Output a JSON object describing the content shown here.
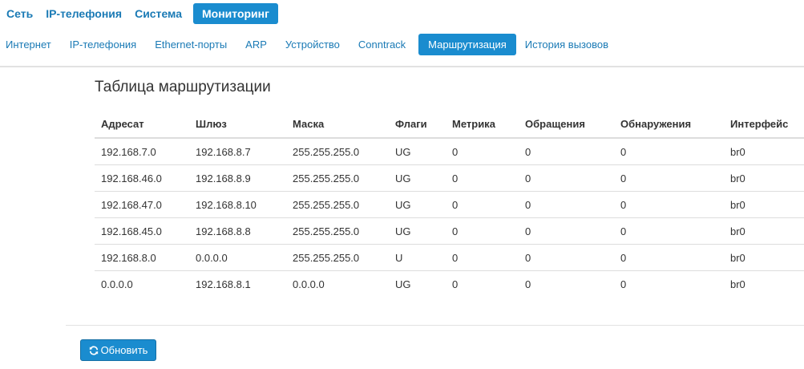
{
  "top_nav": {
    "tabs": [
      {
        "label": "Сеть"
      },
      {
        "label": "IP-телефония"
      },
      {
        "label": "Система"
      },
      {
        "label": "Мониторинг"
      }
    ],
    "active_index": 3
  },
  "sub_nav": {
    "tabs": [
      {
        "label": "Интернет"
      },
      {
        "label": "IP-телефония"
      },
      {
        "label": "Ethernet-порты"
      },
      {
        "label": "ARP"
      },
      {
        "label": "Устройство"
      },
      {
        "label": "Conntrack"
      },
      {
        "label": "Маршрутизация"
      },
      {
        "label": "История вызовов"
      }
    ],
    "active_index": 6
  },
  "page": {
    "title": "Таблица маршрутизации"
  },
  "table": {
    "headers": [
      "Адресат",
      "Шлюз",
      "Маска",
      "Флаги",
      "Метрика",
      "Обращения",
      "Обнаружения",
      "Интерфейс"
    ],
    "rows": [
      [
        "192.168.7.0",
        "192.168.8.7",
        "255.255.255.0",
        "UG",
        "0",
        "0",
        "0",
        "br0"
      ],
      [
        "192.168.46.0",
        "192.168.8.9",
        "255.255.255.0",
        "UG",
        "0",
        "0",
        "0",
        "br0"
      ],
      [
        "192.168.47.0",
        "192.168.8.10",
        "255.255.255.0",
        "UG",
        "0",
        "0",
        "0",
        "br0"
      ],
      [
        "192.168.45.0",
        "192.168.8.8",
        "255.255.255.0",
        "UG",
        "0",
        "0",
        "0",
        "br0"
      ],
      [
        "192.168.8.0",
        "0.0.0.0",
        "255.255.255.0",
        "U",
        "0",
        "0",
        "0",
        "br0"
      ],
      [
        "0.0.0.0",
        "192.168.8.1",
        "0.0.0.0",
        "UG",
        "0",
        "0",
        "0",
        "br0"
      ]
    ]
  },
  "actions": {
    "refresh_label": "Обновить",
    "refresh_icon": "refresh-icon"
  },
  "colors": {
    "accent": "#1a8ccf",
    "link": "#1a7ab5",
    "text": "#333333",
    "divider": "#dddddd"
  }
}
